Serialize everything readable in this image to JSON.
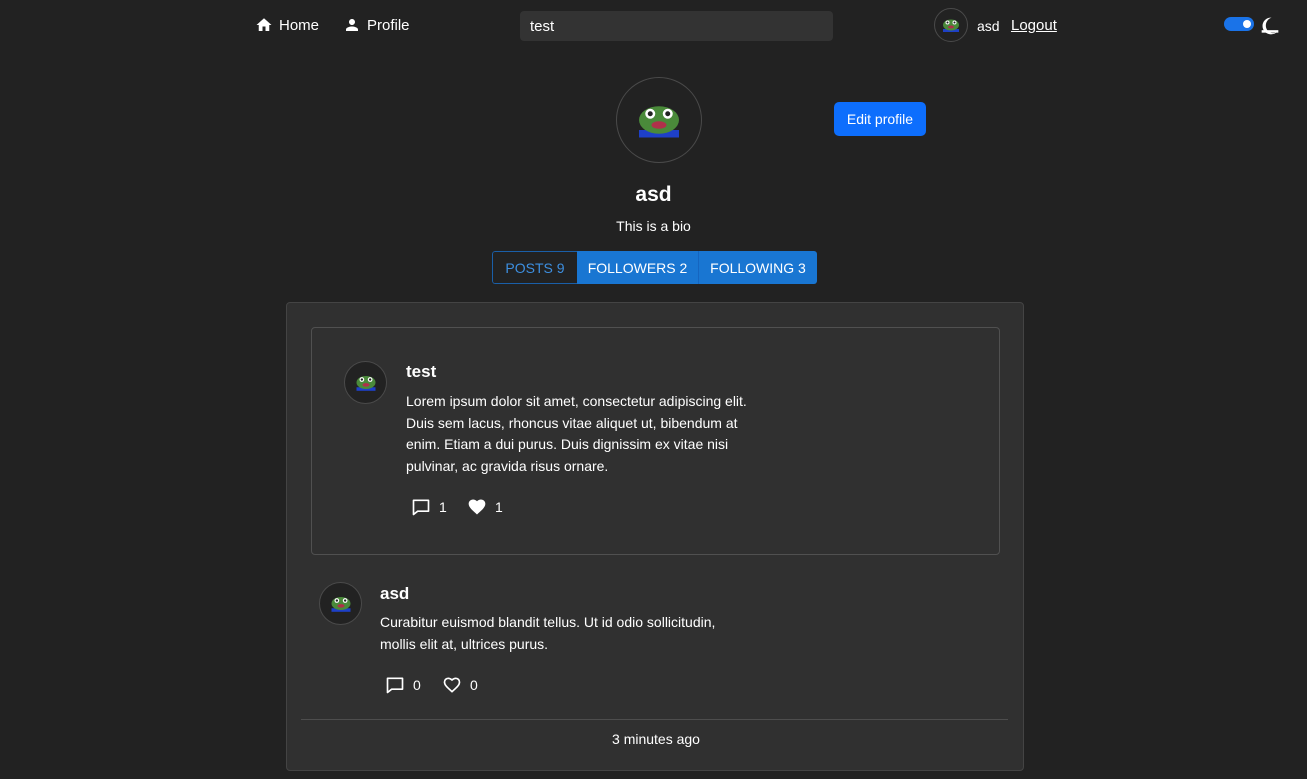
{
  "nav": {
    "home_label": "Home",
    "profile_label": "Profile",
    "search_value": "test",
    "username": "asd",
    "logout_label": "Logout",
    "accent_color": "#1a73e8"
  },
  "profile": {
    "name": "asd",
    "bio": "This is a bio",
    "edit_label": "Edit profile"
  },
  "tabs": [
    {
      "label": "POSTS 9"
    },
    {
      "label": "FOLLOWERS 2"
    },
    {
      "label": "FOLLOWING 3"
    }
  ],
  "posts": [
    {
      "author": "test",
      "body": "Lorem ipsum dolor sit amet, consectetur adipiscing elit. Duis sem lacus, rhoncus vitae aliquet ut, bibendum at enim. Etiam a dui purus. Duis dignissim ex vitae nisi pulvinar, ac gravida risus ornare.",
      "comments": "1",
      "likes": "1",
      "liked": true
    },
    {
      "author": "asd",
      "body": "Curabitur euismod blandit tellus. Ut id odio sollicitudin, mollis elit at, ultrices purus.",
      "comments": "0",
      "likes": "0",
      "liked": false
    }
  ],
  "timestamp": "3 minutes ago",
  "icons": [
    "home-icon",
    "person-icon",
    "moon-icon",
    "comment-icon",
    "heart-icon"
  ]
}
